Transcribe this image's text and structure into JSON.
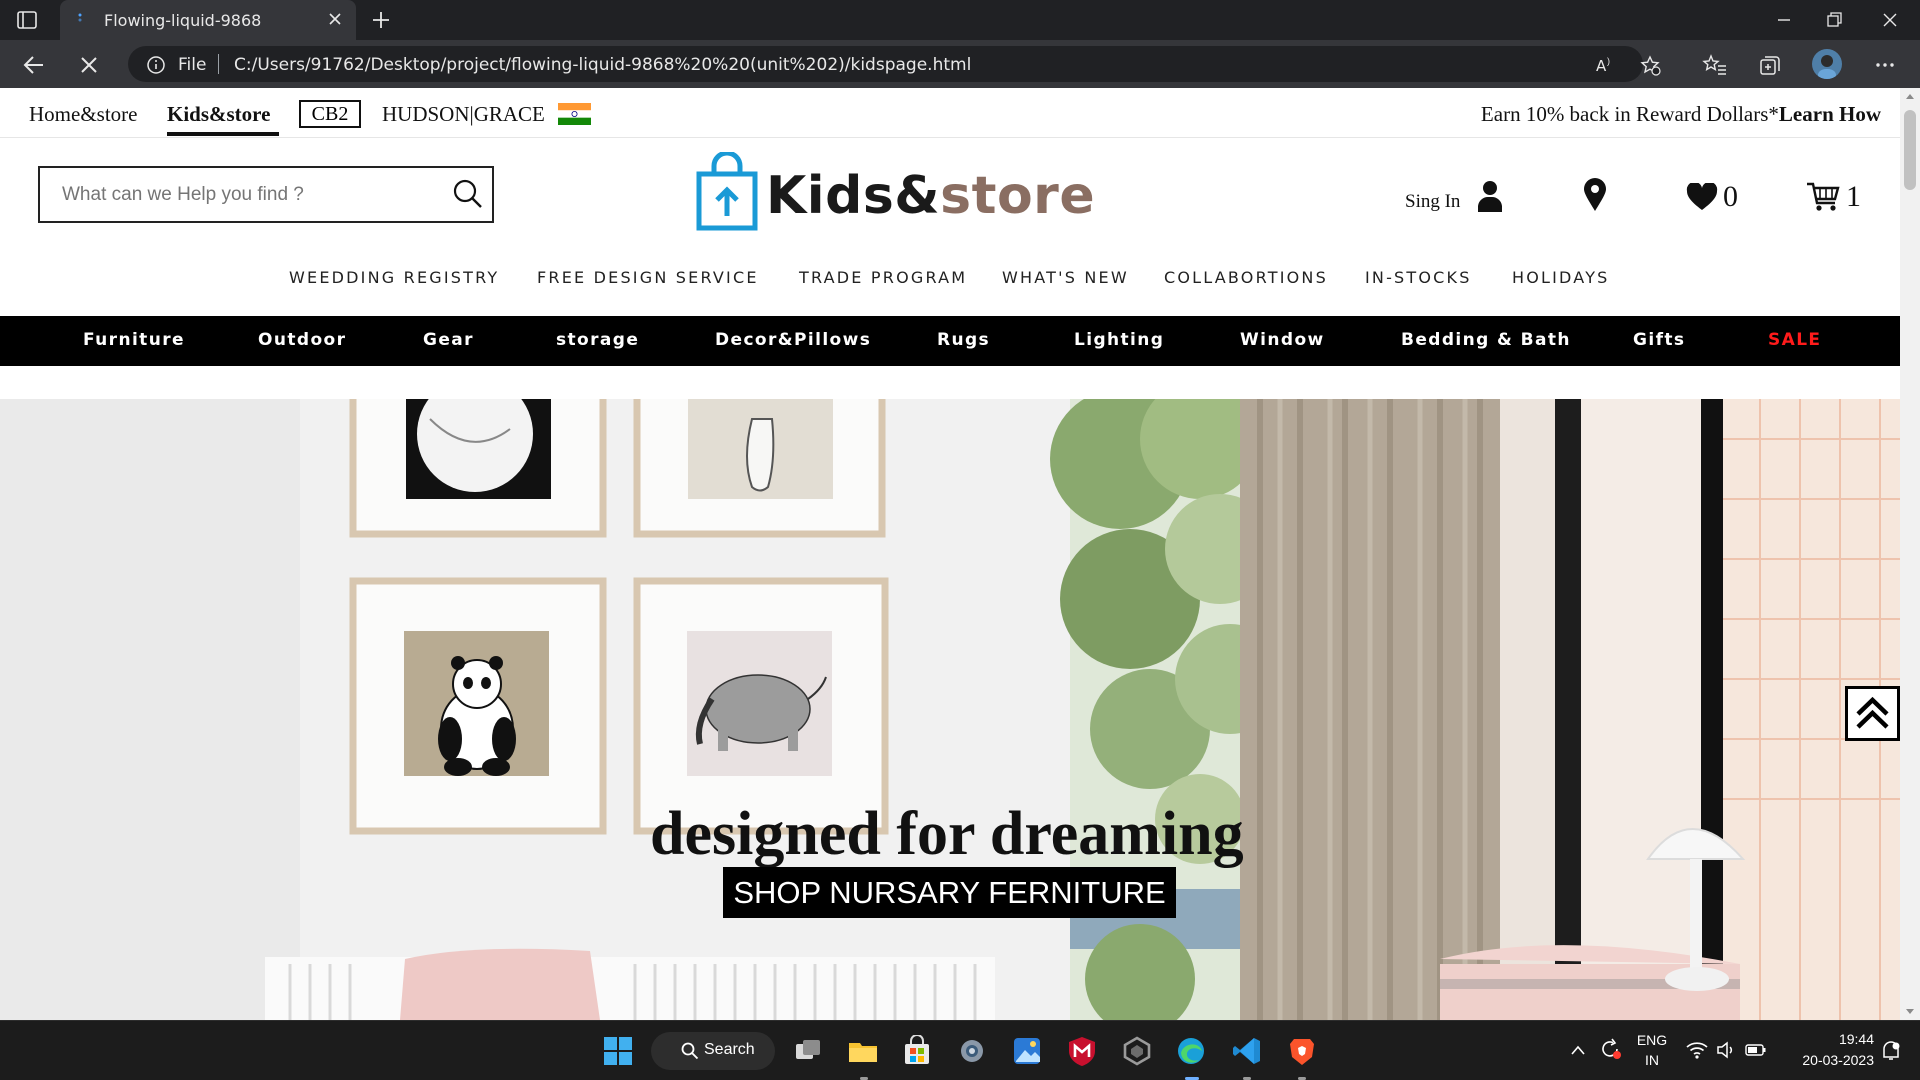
{
  "browser": {
    "tab_title": "Flowing-liquid-9868",
    "scheme_label": "File",
    "url": "C:/Users/91762/Desktop/project/flowing-liquid-9868%20%20(unit%202)/kidspage.html"
  },
  "topstrip": {
    "home": "Home&store",
    "kids": "Kids&store",
    "cb2": "CB2",
    "hudson": "HUDSON|GRACE",
    "reward_text": "Earn 10% back in Reward Dollars*",
    "reward_link": "Learn How"
  },
  "header": {
    "search_placeholder": "What can we Help you find ?",
    "logo_part1": "Kids&",
    "logo_part2": "store",
    "signin": "Sing In",
    "wishlist_count": "0",
    "cart_count": "1"
  },
  "subnav": [
    "WEEDDING REGISTRY",
    "FREE DESIGN SERVICE",
    "TRADE PROGRAM",
    "WHAT'S NEW",
    "COLLABORTIONS",
    "IN-STOCKS",
    "HOLIDAYS"
  ],
  "categories": [
    "Furniture",
    "Outdoor",
    "Gear",
    "storage",
    "Decor&Pillows",
    "Rugs",
    "Lighting",
    "Window",
    "Bedding & Bath",
    "Gifts",
    "SALE"
  ],
  "hero": {
    "title": "designed for dreaming",
    "cta": "SHOP NURSARY FERNITURE"
  },
  "taskbar": {
    "search_label": "Search",
    "lang_top": "ENG",
    "lang_bottom": "IN",
    "time": "19:44",
    "date": "20-03-2023"
  },
  "colors": {
    "sale": "#ff1b1b",
    "logo_blue": "#1a9ad6",
    "logo_brown": "#8a6e62",
    "category_bar": "#000000"
  }
}
